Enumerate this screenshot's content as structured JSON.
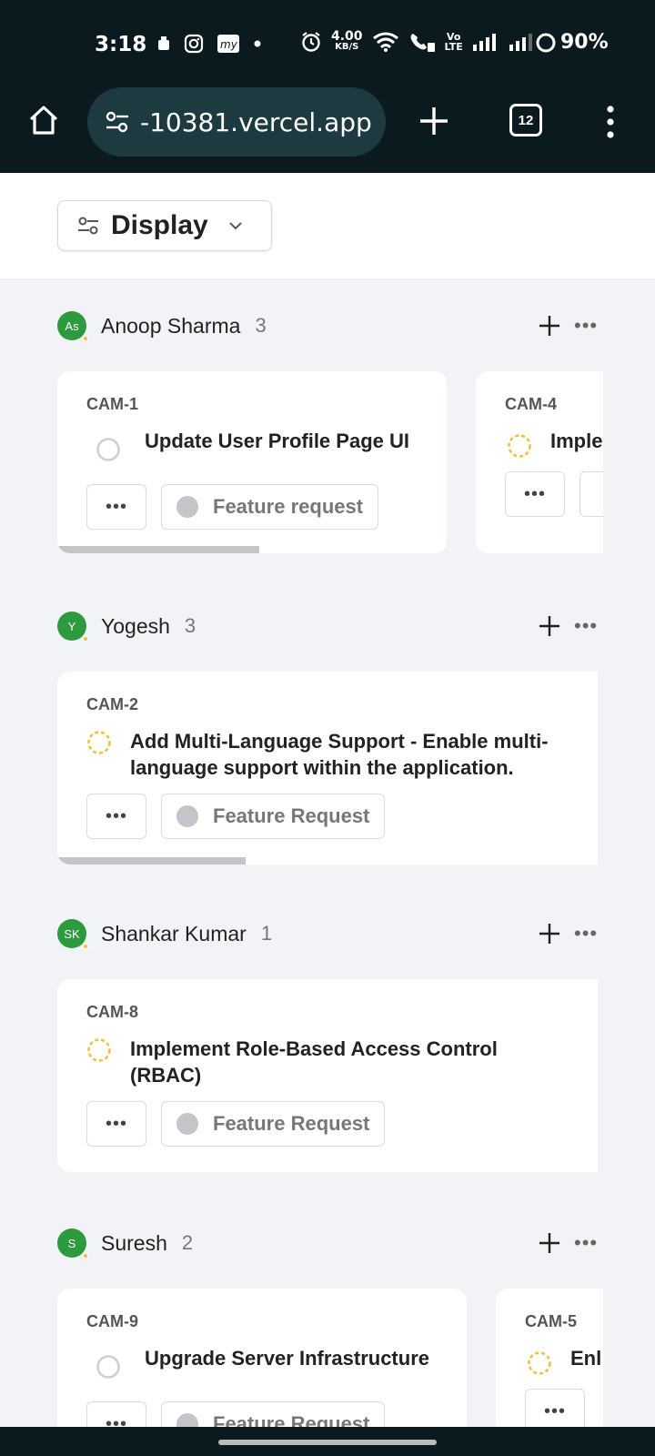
{
  "status_bar": {
    "time": "3:18",
    "net_speed_top": "4.00",
    "net_speed_bottom": "KB/S",
    "volte": "Vo",
    "lte": "LTE",
    "battery": "90%"
  },
  "browser": {
    "url": "-10381.vercel.app",
    "tab_count": "12"
  },
  "toolbar": {
    "display_label": "Display"
  },
  "groups": [
    {
      "name": "Anoop Sharma",
      "initials": "As",
      "count": "3",
      "cards": [
        {
          "id": "CAM-1",
          "title": "Update User Profile Page UI",
          "tag": "Feature request",
          "more": "•••"
        },
        {
          "id": "CAM-4",
          "title": "Imple",
          "more": "•••"
        }
      ]
    },
    {
      "name": "Yogesh",
      "initials": "Y",
      "count": "3",
      "cards": [
        {
          "id": "CAM-2",
          "title_line1": "Add Multi-Language Support - Enable multi-",
          "title_line2": "language support within the application.",
          "tag": "Feature Request",
          "more": "•••"
        }
      ]
    },
    {
      "name": "Shankar Kumar",
      "initials": "SK",
      "count": "1",
      "cards": [
        {
          "id": "CAM-8",
          "title_line1": "Implement Role-Based Access Control",
          "title_line2": "(RBAC)",
          "tag": "Feature Request",
          "more": "•••"
        }
      ]
    },
    {
      "name": "Suresh",
      "initials": "S",
      "count": "2",
      "cards": [
        {
          "id": "CAM-9",
          "title": "Upgrade Server Infrastructure",
          "tag": "Feature Request",
          "more": "•••"
        },
        {
          "id": "CAM-5",
          "title": "Enl",
          "more": "•••"
        }
      ]
    }
  ],
  "group_more": "•••",
  "colors": {
    "chrome": "#0b1a1f",
    "avatar": "#2e9a3e",
    "in_progress": "#f0c040",
    "todo": "#c8c8cc"
  }
}
